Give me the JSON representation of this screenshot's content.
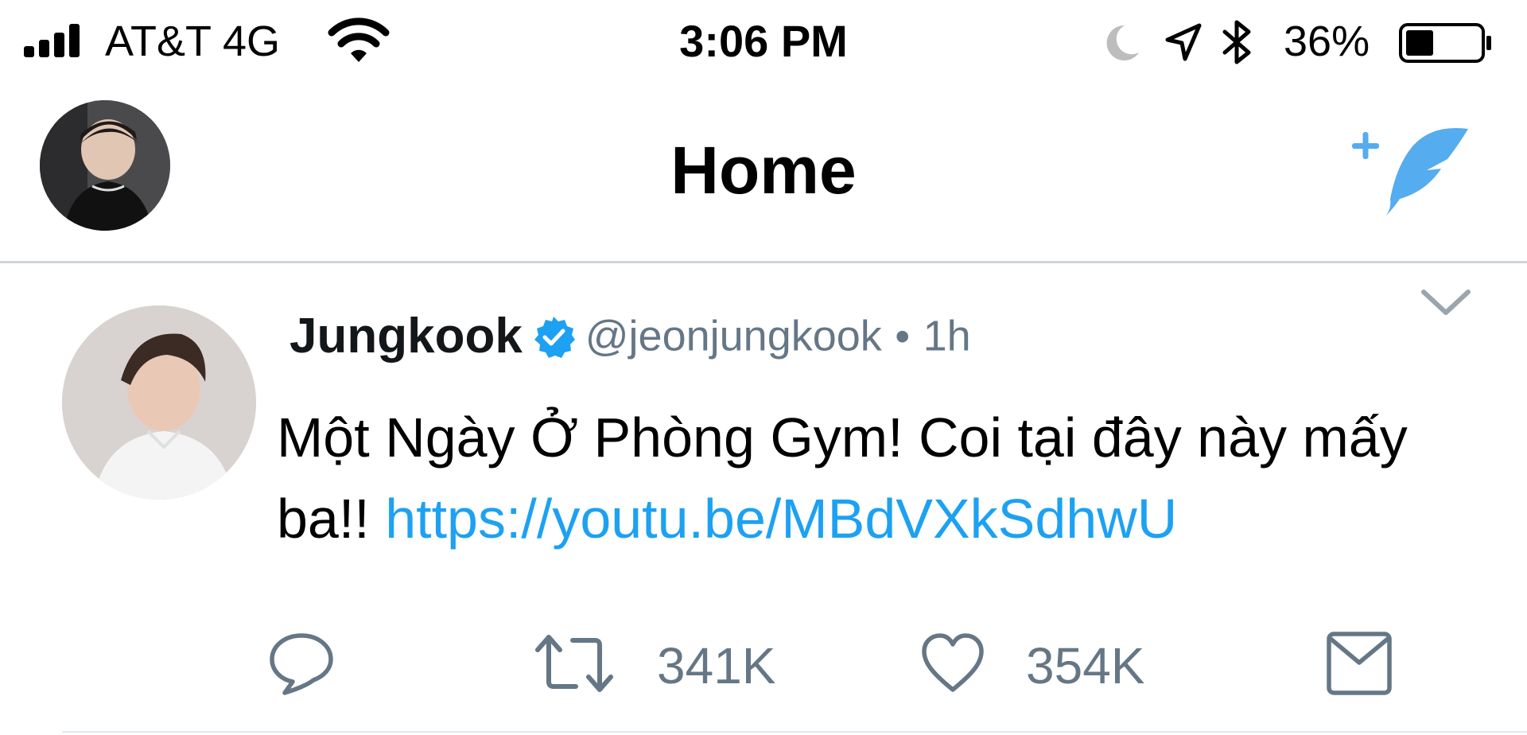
{
  "status_bar": {
    "carrier": "AT&T 4G",
    "time": "3:06 PM",
    "battery_percent": "36%",
    "battery_level": 0.36,
    "icons": [
      "signal-icon",
      "wifi-icon",
      "moon-icon",
      "location-arrow-icon",
      "bluetooth-icon",
      "battery-icon"
    ]
  },
  "header": {
    "title": "Home",
    "compose_icon": "compose-tweet-icon"
  },
  "tweet": {
    "display_name": "Jungkook",
    "verified": true,
    "handle": "@jeonjungkook",
    "separator": "•",
    "time": "1h",
    "text": "Một Ngày Ở Phòng Gym! Coi tại đây này mấy ba!! ",
    "link": "https://youtu.be/MBdVXkSdhwU",
    "retweets": "341K",
    "likes": "354K"
  },
  "colors": {
    "accent": "#1da1f2",
    "compose": "#55acee",
    "secondary_text": "#657786",
    "divider": "#cfd4d9"
  }
}
